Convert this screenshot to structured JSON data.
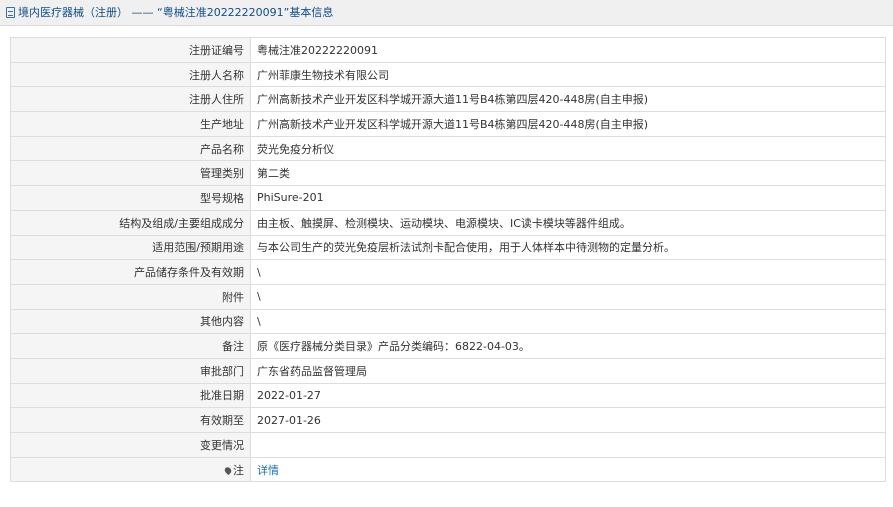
{
  "header": {
    "title": "境内医疗器械（注册） —— “粤械注准20222220091”基本信息"
  },
  "rows": [
    {
      "label": "注册证编号",
      "value": "粤械注准20222220091"
    },
    {
      "label": "注册人名称",
      "value": "广州菲康生物技术有限公司"
    },
    {
      "label": "注册人住所",
      "value": "广州高新技术产业开发区科学城开源大道11号B4栋第四层420-448房(自主申报)"
    },
    {
      "label": "生产地址",
      "value": "广州高新技术产业开发区科学城开源大道11号B4栋第四层420-448房(自主申报)"
    },
    {
      "label": "产品名称",
      "value": "荧光免疫分析仪"
    },
    {
      "label": "管理类别",
      "value": "第二类"
    },
    {
      "label": "型号规格",
      "value": "PhiSure-201"
    },
    {
      "label": "结构及组成/主要组成成分",
      "value": "由主板、触摸屏、检测模块、运动模块、电源模块、IC读卡模块等器件组成。"
    },
    {
      "label": "适用范围/预期用途",
      "value": "与本公司生产的荧光免疫层析法试剂卡配合使用，用于人体样本中待测物的定量分析。"
    },
    {
      "label": "产品储存条件及有效期",
      "value": "\\"
    },
    {
      "label": "附件",
      "value": "\\"
    },
    {
      "label": "其他内容",
      "value": "\\"
    },
    {
      "label": "备注",
      "value": "原《医疗器械分类目录》产品分类编码：6822-04-03。"
    },
    {
      "label": "审批部门",
      "value": "广东省药品监督管理局"
    },
    {
      "label": "批准日期",
      "value": "2022-01-27"
    },
    {
      "label": "有效期至",
      "value": "2027-01-26"
    },
    {
      "label": "变更情况",
      "value": ""
    }
  ],
  "note_row": {
    "label": "注",
    "link": "详情"
  },
  "icons": {
    "title": "document-icon",
    "note": "pin-icon"
  }
}
